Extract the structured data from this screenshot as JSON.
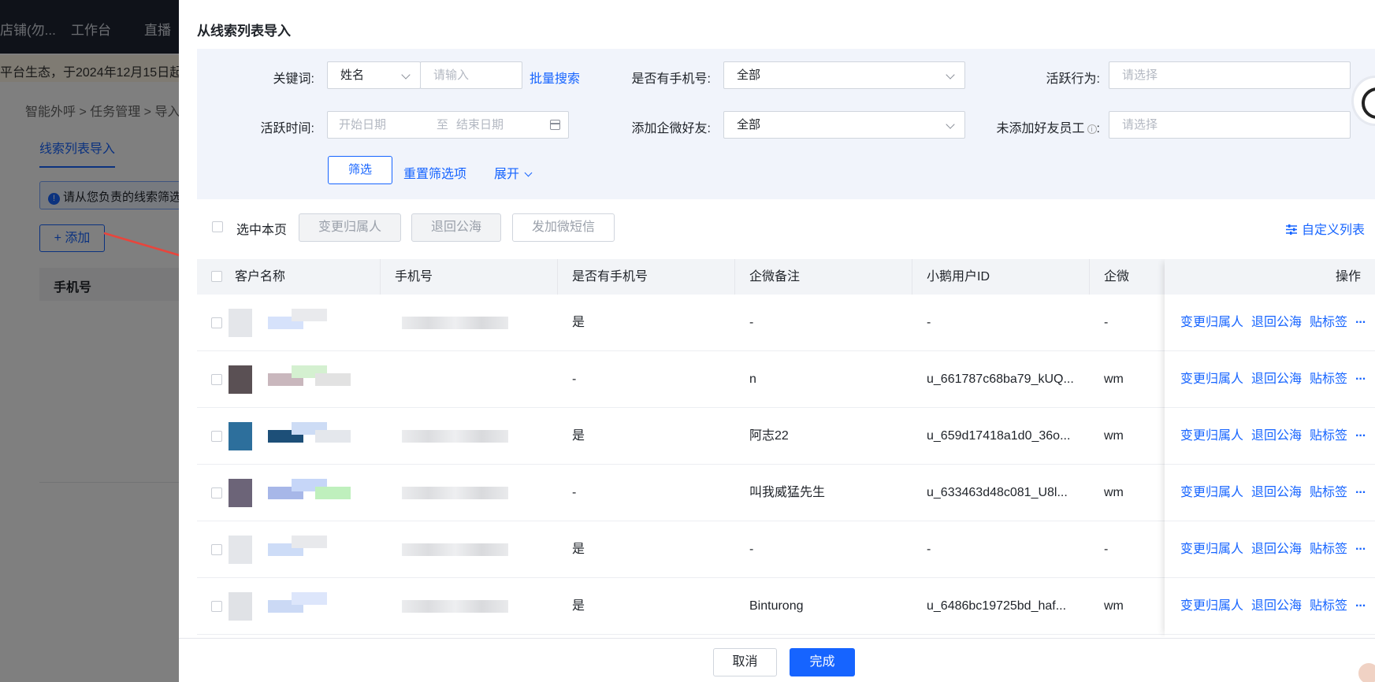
{
  "background": {
    "topbar": {
      "shop": "店铺(勿...",
      "workbench": "工作台",
      "live": "直播"
    },
    "notice": "平台生态，于2024年12月15日起，",
    "breadcrumb": "智能外呼 > 任务管理 > 导入",
    "tab": "线索列表导入",
    "alert": "请从您负责的线索筛选",
    "add_button": "+ 添加",
    "table_header": "手机号"
  },
  "drawer": {
    "title": "从线索列表导入",
    "filters": {
      "keyword_label": "关键词:",
      "keyword_type": "姓名",
      "keyword_placeholder": "请输入",
      "batch_search": "批量搜索",
      "has_phone_label": "是否有手机号:",
      "has_phone_value": "全部",
      "active_behavior_label": "活跃行为:",
      "active_behavior_placeholder": "请选择",
      "active_time_label": "活跃时间:",
      "start_date_placeholder": "开始日期",
      "date_separator": "至",
      "end_date_placeholder": "结束日期",
      "add_wecom_label": "添加企微好友:",
      "add_wecom_value": "全部",
      "not_added_staff_label": "未添加好友员工",
      "not_added_staff_colon": ":",
      "not_added_staff_placeholder": "请选择",
      "filter_button": "筛选",
      "reset_button": "重置筛选项",
      "expand_button": "展开"
    },
    "toolbar": {
      "select_page": "选中本页",
      "change_owner": "变更归属人",
      "return_pool": "退回公海",
      "send_sms": "发加微短信",
      "custom_columns": "自定义列表"
    },
    "table": {
      "headers": {
        "name": "客户名称",
        "phone": "手机号",
        "has_phone": "是否有手机号",
        "remark": "企微备注",
        "user_id": "小鹅用户ID",
        "wecom": "企微",
        "actions": "操作"
      },
      "rows": [
        {
          "has_phone": "是",
          "remark": "-",
          "user_id": "-",
          "wecom": "-"
        },
        {
          "has_phone": "-",
          "remark": "n",
          "user_id": "u_661787c68ba79_kUQ...",
          "wecom": "wm"
        },
        {
          "has_phone": "是",
          "remark": "阿志22",
          "user_id": "u_659d17418a1d0_36o...",
          "wecom": "wm"
        },
        {
          "has_phone": "-",
          "remark": "叫我威猛先生",
          "user_id": "u_633463d48c081_U8l...",
          "wecom": "wm"
        },
        {
          "has_phone": "是",
          "remark": "-",
          "user_id": "-",
          "wecom": "-"
        },
        {
          "has_phone": "是",
          "remark": "Binturong",
          "user_id": "u_6486bc19725bd_haf...",
          "wecom": "wm"
        }
      ],
      "row_actions": {
        "change_owner": "变更归属人",
        "return_pool": "退回公海",
        "tag": "贴标签",
        "more": "···"
      }
    },
    "footer": {
      "cancel": "取消",
      "done": "完成"
    }
  },
  "colors": {
    "accent": "#1664ff",
    "filter_bg": "#f1f4fb",
    "header_bg": "#f2f4f7"
  }
}
